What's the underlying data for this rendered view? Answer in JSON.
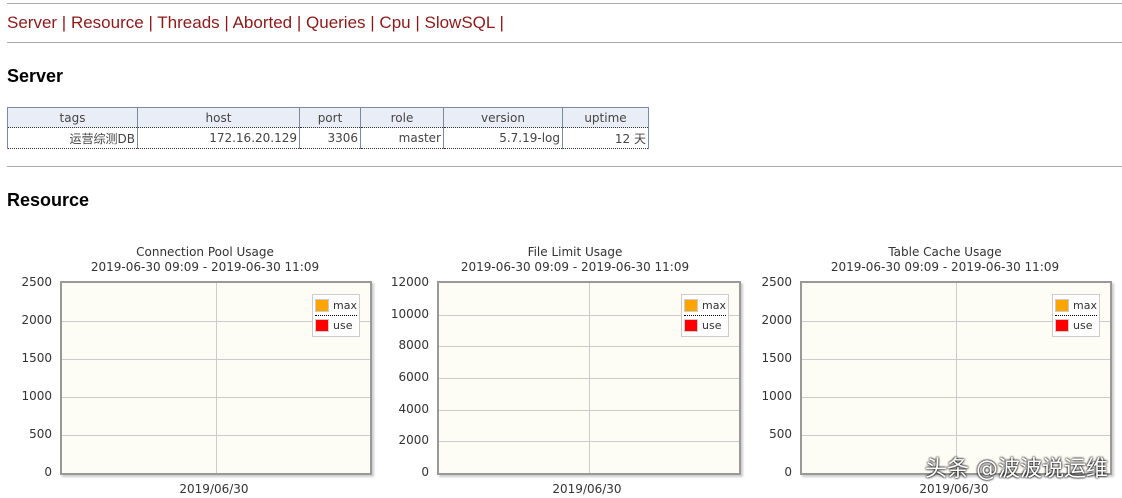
{
  "nav": [
    "Server",
    "Resource",
    "Threads",
    "Aborted",
    "Queries",
    "Cpu",
    "SlowSQL"
  ],
  "server": {
    "heading": "Server",
    "columns": [
      "tags",
      "host",
      "port",
      "role",
      "version",
      "uptime"
    ],
    "rows": [
      [
        "运营综测DB",
        "172.16.20.129",
        "3306",
        "master",
        "5.7.19-log",
        "12 天"
      ]
    ]
  },
  "resource": {
    "heading": "Resource"
  },
  "chart_data": [
    {
      "type": "line",
      "title": "Connection Pool Usage",
      "subtitle": "2019-06-30 09:09 - 2019-06-30 11:09",
      "ylim": [
        0,
        2500
      ],
      "yticks": [
        "2500",
        "2000",
        "1500",
        "1000",
        "500",
        "0"
      ],
      "xticks": [
        "2019/06/30"
      ],
      "legend": [
        "max",
        "use"
      ],
      "legend_position": "top-right",
      "series": [
        {
          "name": "max",
          "values": []
        },
        {
          "name": "use",
          "values": []
        }
      ]
    },
    {
      "type": "line",
      "title": "File Limit Usage",
      "subtitle": "2019-06-30 09:09 - 2019-06-30 11:09",
      "ylim": [
        0,
        12000
      ],
      "yticks": [
        "12000",
        "10000",
        "8000",
        "6000",
        "4000",
        "2000",
        "0"
      ],
      "xticks": [
        "2019/06/30"
      ],
      "legend": [
        "max",
        "use"
      ],
      "legend_position": "top-right",
      "series": [
        {
          "name": "max",
          "values": []
        },
        {
          "name": "use",
          "values": []
        }
      ]
    },
    {
      "type": "line",
      "title": "Table Cache Usage",
      "subtitle": "2019-06-30 09:09 - 2019-06-30 11:09",
      "ylim": [
        0,
        2500
      ],
      "yticks": [
        "2500",
        "2000",
        "1500",
        "1000",
        "500",
        "0"
      ],
      "xticks": [
        "2019/06/30"
      ],
      "legend": [
        "max",
        "use"
      ],
      "legend_position": "top-right",
      "series": [
        {
          "name": "max",
          "values": []
        },
        {
          "name": "use",
          "values": []
        }
      ]
    }
  ],
  "colors": {
    "max": "#ffa500",
    "use": "#ff0000"
  },
  "watermark": "头条 @波波说运维"
}
